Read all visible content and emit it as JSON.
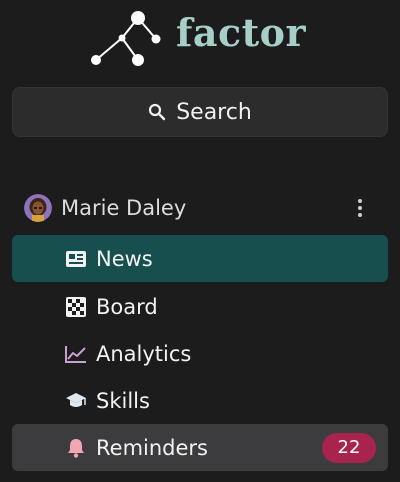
{
  "brand": {
    "name": "factor",
    "color": "#a7cfc9"
  },
  "search": {
    "label": "Search",
    "icon": "search-icon"
  },
  "user": {
    "name": "Marie Daley",
    "menu_icon": "kebab-menu-icon"
  },
  "nav": {
    "items": [
      {
        "label": "News",
        "icon": "newspaper-icon",
        "active": true
      },
      {
        "label": "Board",
        "icon": "checkerboard-icon"
      },
      {
        "label": "Analytics",
        "icon": "line-chart-icon"
      },
      {
        "label": "Skills",
        "icon": "graduation-cap-icon"
      },
      {
        "label": "Reminders",
        "icon": "bell-icon",
        "badge": "22"
      }
    ]
  },
  "colors": {
    "background": "#1c1c1d",
    "active_item": "#174f4f",
    "hover_item": "#3c3c3e",
    "badge": "#a9244d",
    "analytics_icon": "#c8a0d2",
    "bell_icon": "#f2a6b2"
  }
}
